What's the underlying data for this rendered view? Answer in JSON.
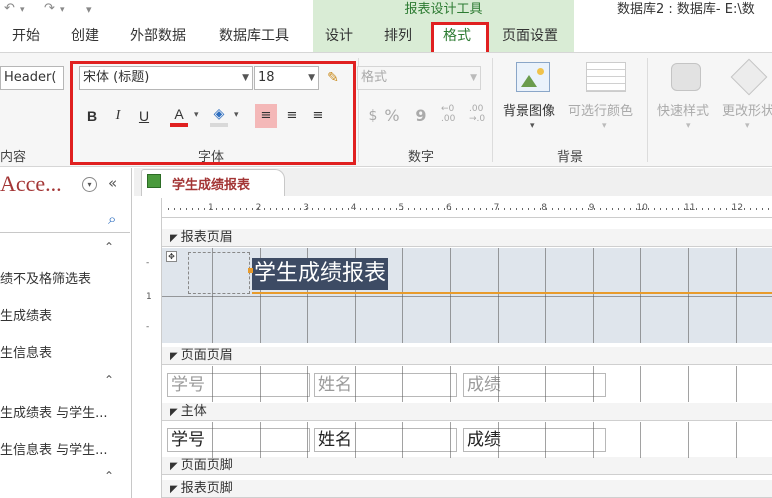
{
  "titlebar": {
    "context_title": "报表设计工具",
    "app_title": "数据库2 : 数据库- E:\\数"
  },
  "tabs": [
    {
      "label": "开始"
    },
    {
      "label": "创建"
    },
    {
      "label": "外部数据"
    },
    {
      "label": "数据库工具"
    },
    {
      "label": "设计"
    },
    {
      "label": "排列"
    },
    {
      "label": "格式"
    },
    {
      "label": "页面设置"
    }
  ],
  "ribbon": {
    "object_select": "Header(",
    "group_content_label": "内容",
    "font_name": "宋体 (标题)",
    "font_size": "18",
    "format_combo_placeholder": "格式",
    "group_font_label": "字体",
    "group_number_label": "数字",
    "percent_symbol": "%",
    "comma_symbol": "9",
    "inc_decimals": "←0\n.00",
    "dec_decimals": ".00\n→.0",
    "background_image_label": "背景图像",
    "alt_row_color_label": "可选行颜色",
    "group_background_label": "背景",
    "quick_styles_label": "快速样式",
    "change_shape_label": "更改形状"
  },
  "nav": {
    "title": "Acce...",
    "items": [
      {
        "label": "绩不及格筛选表"
      },
      {
        "label": "生成绩表"
      },
      {
        "label": "生信息表"
      },
      {
        "label": "生成绩表 与学生..."
      },
      {
        "label": "生信息表 与学生..."
      }
    ]
  },
  "document": {
    "tab_label": "学生成绩报表",
    "ruler_numbers": [
      "1",
      "2",
      "3",
      "4",
      "5",
      "6",
      "7",
      "8",
      "9",
      "10",
      "11",
      "12"
    ],
    "bands": {
      "report_header": "报表页眉",
      "page_header": "页面页眉",
      "detail": "主体",
      "page_footer": "页面页脚",
      "report_footer": "报表页脚"
    },
    "report_title": "学生成绩报表",
    "page_header_labels": [
      "学号",
      "姓名",
      "成绩"
    ],
    "detail_fields": [
      "学号",
      "姓名",
      "成绩"
    ]
  },
  "colors": {
    "highlight_red": "#e02020",
    "context_green": "#2d7b32",
    "context_bg": "#d9ecd5",
    "nav_title_red": "#a33535"
  }
}
